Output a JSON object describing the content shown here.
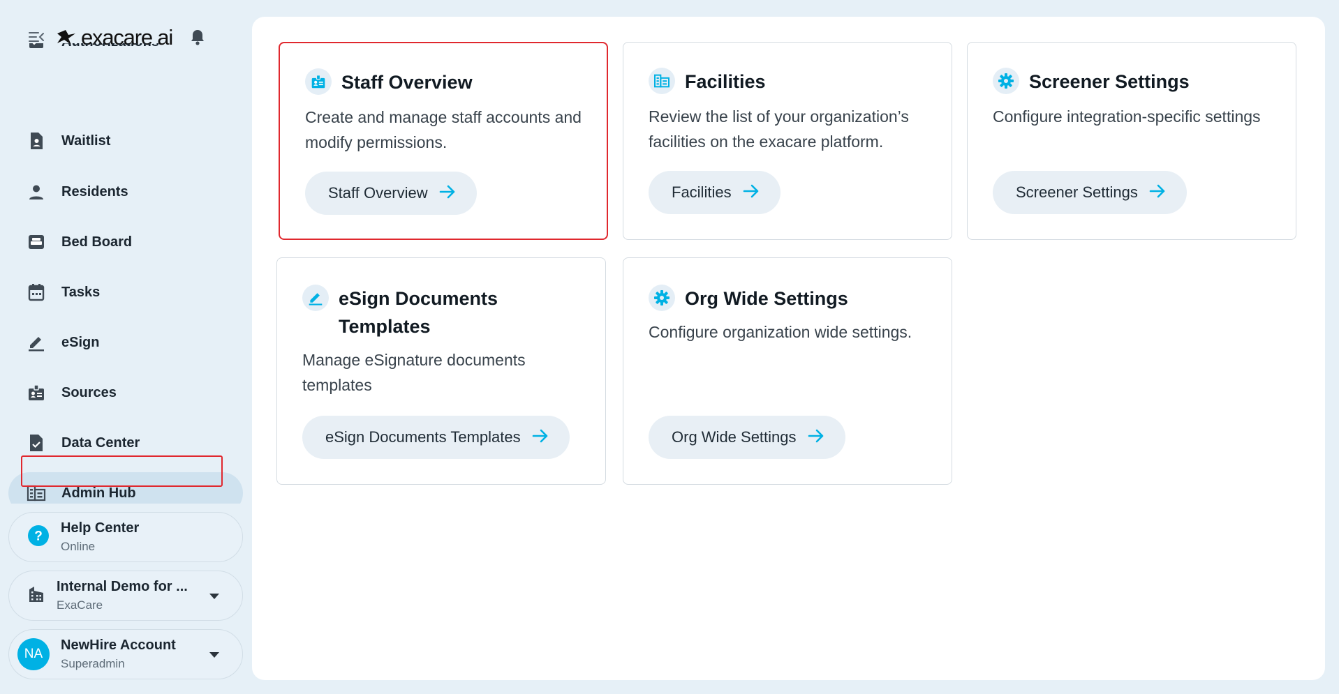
{
  "brand": {
    "logo_text": "exacare ai"
  },
  "sidebar": {
    "items": [
      {
        "label": "Authorizations",
        "icon": "authorizations-icon"
      },
      {
        "label": "Waitlist",
        "icon": "waitlist-icon"
      },
      {
        "label": "Residents",
        "icon": "person-icon"
      },
      {
        "label": "Bed Board",
        "icon": "bed-icon"
      },
      {
        "label": "Tasks",
        "icon": "calendar-icon"
      },
      {
        "label": "eSign",
        "icon": "pen-icon"
      },
      {
        "label": "Sources",
        "icon": "id-badge-icon"
      },
      {
        "label": "Data Center",
        "icon": "document-check-icon"
      },
      {
        "label": "Admin Hub",
        "icon": "building-list-icon",
        "active": true
      }
    ],
    "help": {
      "title": "Help Center",
      "status": "Online"
    },
    "organization": {
      "name": "Internal Demo for ...",
      "sub": "ExaCare"
    },
    "account": {
      "initials": "NA",
      "name": "NewHire Account",
      "role": "Superadmin"
    }
  },
  "tiles": [
    {
      "title": "Staff Overview",
      "description": "Create and manage staff accounts and modify permissions.",
      "button": "Staff Overview",
      "icon": "id-badge-icon"
    },
    {
      "title": "Facilities",
      "description": "Review the list of your organization’s facilities on the exacare platform.",
      "button": "Facilities",
      "icon": "building-list-icon"
    },
    {
      "title": "Screener Settings",
      "description": "Configure integration-specific settings",
      "button": "Screener Settings",
      "icon": "gear-icon"
    },
    {
      "title": "eSign Documents Templates",
      "description": "Manage eSignature documents templates",
      "button": "eSign Documents Templates",
      "icon": "pen-icon"
    },
    {
      "title": "Org Wide Settings",
      "description": "Configure organization wide settings.",
      "button": "Org Wide Settings",
      "icon": "gear-icon"
    }
  ],
  "colors": {
    "accent": "#00b1e4",
    "highlight": "#e0282e",
    "active_nav": "#cfe2ef"
  }
}
